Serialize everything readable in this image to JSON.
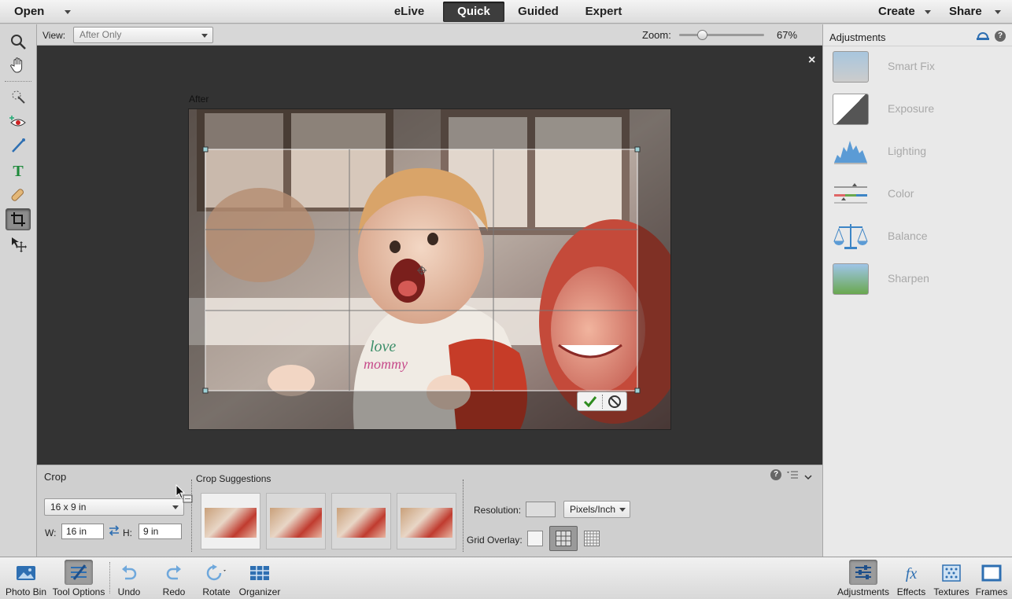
{
  "topbar": {
    "open": "Open",
    "modes": [
      "eLive",
      "Quick",
      "Guided",
      "Expert"
    ],
    "active_mode": "Quick",
    "create": "Create",
    "share": "Share"
  },
  "optbar": {
    "view_label": "View:",
    "view_value": "After Only",
    "zoom_label": "Zoom:",
    "zoom_value": "67%",
    "zoom_fraction": 0.27
  },
  "canvas": {
    "image_label": "After",
    "close": "×"
  },
  "toolopts": {
    "title": "Crop",
    "preset": "16 x 9 in",
    "w_label": "W:",
    "w_value": "16 in",
    "h_label": "H:",
    "h_value": "9 in",
    "suggestions_label": "Crop Suggestions",
    "resolution_label": "Resolution:",
    "resolution_value": "",
    "resolution_unit": "Pixels/Inch",
    "grid_label": "Grid Overlay:"
  },
  "rpanel": {
    "title": "Adjustments",
    "items": [
      "Smart Fix",
      "Exposure",
      "Lighting",
      "Color",
      "Balance",
      "Sharpen"
    ]
  },
  "bottombar": {
    "left": [
      "Photo Bin",
      "Tool Options",
      "Undo",
      "Redo",
      "Rotate",
      "Organizer"
    ],
    "right": [
      "Adjustments",
      "Effects",
      "Textures",
      "Frames"
    ]
  },
  "colors": {
    "accent_dark": "#3d3d3d",
    "crop_green": "#2e8b1e",
    "icon_blue": "#2e6fb2"
  }
}
